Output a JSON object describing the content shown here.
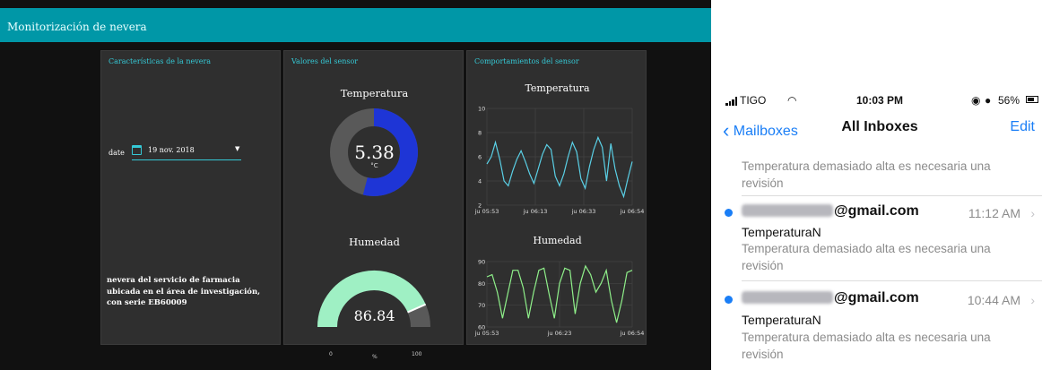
{
  "dashboard": {
    "title": "Monitorización de nevera",
    "panels": {
      "features": {
        "title": "Características de la nevera",
        "date_label": "date",
        "date_value": "19 nov. 2018",
        "description": "nevera del servicio de farmacia ubicada en el área de investigación, con serie EB60009"
      },
      "sensor": {
        "title": "Valores del sensor",
        "temperature": {
          "label": "Temperatura",
          "value": "5.38",
          "unit": "°C",
          "fraction": 0.54
        },
        "humidity": {
          "label": "Humedad",
          "value": "86.84",
          "unit": "%",
          "min": "0",
          "max": "100",
          "fraction": 0.8684
        }
      },
      "behavior": {
        "title": "Comportamientos del sensor"
      }
    },
    "colors": {
      "topbar": "#0097a7",
      "accent": "#35c9d6",
      "temp_fill": "#1e35d6",
      "humidity_fill": "#9ff0c4",
      "gauge_bg": "#595959",
      "temp_line": "#5ad0e6",
      "hum_line": "#8ff08a"
    }
  },
  "chart_data": [
    {
      "type": "line",
      "title": "Temperatura",
      "xlabel": "",
      "ylabel": "",
      "ylim": [
        2,
        10
      ],
      "yticks": [
        "10",
        "8",
        "6",
        "4",
        "2"
      ],
      "xticks": [
        "ju 05:53",
        "ju 06:13",
        "ju 06:33",
        "ju 06:54"
      ],
      "y": [
        5.4,
        6.0,
        7.2,
        5.8,
        4.0,
        3.6,
        4.8,
        5.8,
        6.5,
        5.6,
        4.6,
        3.8,
        5.0,
        6.2,
        7.0,
        6.6,
        4.4,
        3.6,
        4.6,
        6.0,
        7.2,
        6.4,
        4.2,
        3.4,
        5.2,
        6.6,
        7.6,
        6.8,
        4.0,
        7.1,
        5.0,
        3.6,
        2.7,
        4.2,
        5.6
      ]
    },
    {
      "type": "line",
      "title": "Humedad",
      "xlabel": "",
      "ylabel": "",
      "ylim": [
        60,
        90
      ],
      "yticks": [
        "90",
        "80",
        "70",
        "60"
      ],
      "xticks": [
        "ju 05:53",
        "ju 06:23",
        "ju 06:54"
      ],
      "y": [
        83,
        84,
        76,
        64,
        75,
        86,
        86,
        78,
        64,
        76,
        86,
        87,
        75,
        64,
        80,
        87,
        86,
        66,
        80,
        88,
        84,
        76,
        80,
        86,
        72,
        62,
        72,
        85,
        86
      ]
    }
  ],
  "phone": {
    "status": {
      "carrier": "TIGO",
      "time": "10:03 PM",
      "battery": "56%"
    },
    "nav": {
      "back_label": "Mailboxes",
      "title": "All Inboxes",
      "edit_label": "Edit"
    },
    "top_snippet": "Temperatura demasiado alta es necesaria una revisión",
    "emails": [
      {
        "sender_domain": "@gmail.com",
        "time": "11:12 AM",
        "subject": "TemperaturaN",
        "preview": "Temperatura demasiado alta es necesaria una revisión"
      },
      {
        "sender_domain": "@gmail.com",
        "time": "10:44 AM",
        "subject": "TemperaturaN",
        "preview": "Temperatura demasiado alta es necesaria una revisión"
      }
    ]
  }
}
